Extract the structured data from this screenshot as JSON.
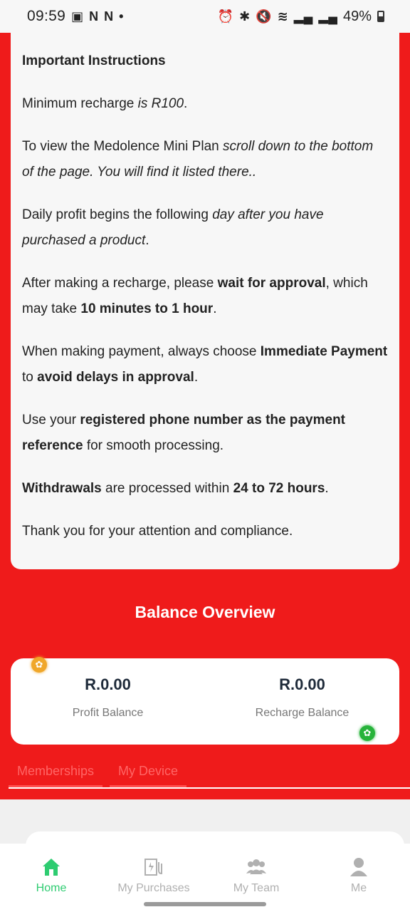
{
  "status_bar": {
    "time": "09:59",
    "battery": "49%"
  },
  "instructions": {
    "title": "Important Instructions",
    "p1": {
      "a": "Minimum recharge ",
      "b": "is R100",
      "c": "."
    },
    "p2": {
      "a": "To view the Medolence Mini Plan ",
      "b": "scroll down to the bottom of the page. You will find it listed there.."
    },
    "p3": {
      "a": "Daily profit begins the following ",
      "b": "day after you have purchased a product",
      "c": "."
    },
    "p4": {
      "a": "After making a recharge, please ",
      "b": "wait for approval",
      "c": ", which may take ",
      "d": "10 minutes to 1 hour",
      "e": "."
    },
    "p5": {
      "a": "When making payment, always choose ",
      "b": "Immediate Payment",
      "c": " to ",
      "d": "avoid delays in approval",
      "e": "."
    },
    "p6": {
      "a": "Use your ",
      "b": "registered phone number as the payment reference",
      "c": " for smooth processing."
    },
    "p7": {
      "a": "Withdrawals",
      "b": " are processed within ",
      "c": "24 to 72 hours",
      "d": "."
    },
    "p8": "Thank you for your attention and compliance."
  },
  "balance": {
    "title": "Balance Overview",
    "profit_value": "R.0.00",
    "profit_label": "Profit Balance",
    "recharge_value": "R.0.00",
    "recharge_label": "Recharge Balance"
  },
  "tabs": [
    "Memberships",
    "My Device"
  ],
  "nav": {
    "items": [
      {
        "label": "Home",
        "icon": "home-icon",
        "active": true
      },
      {
        "label": "My Purchases",
        "icon": "purchases-icon",
        "active": false
      },
      {
        "label": "My Team",
        "icon": "team-icon",
        "active": false
      },
      {
        "label": "Me",
        "icon": "profile-icon",
        "active": false
      }
    ]
  },
  "colors": {
    "background": "#ef1b1b",
    "accent_green": "#2ecc71",
    "card": "#f7f7f7"
  }
}
